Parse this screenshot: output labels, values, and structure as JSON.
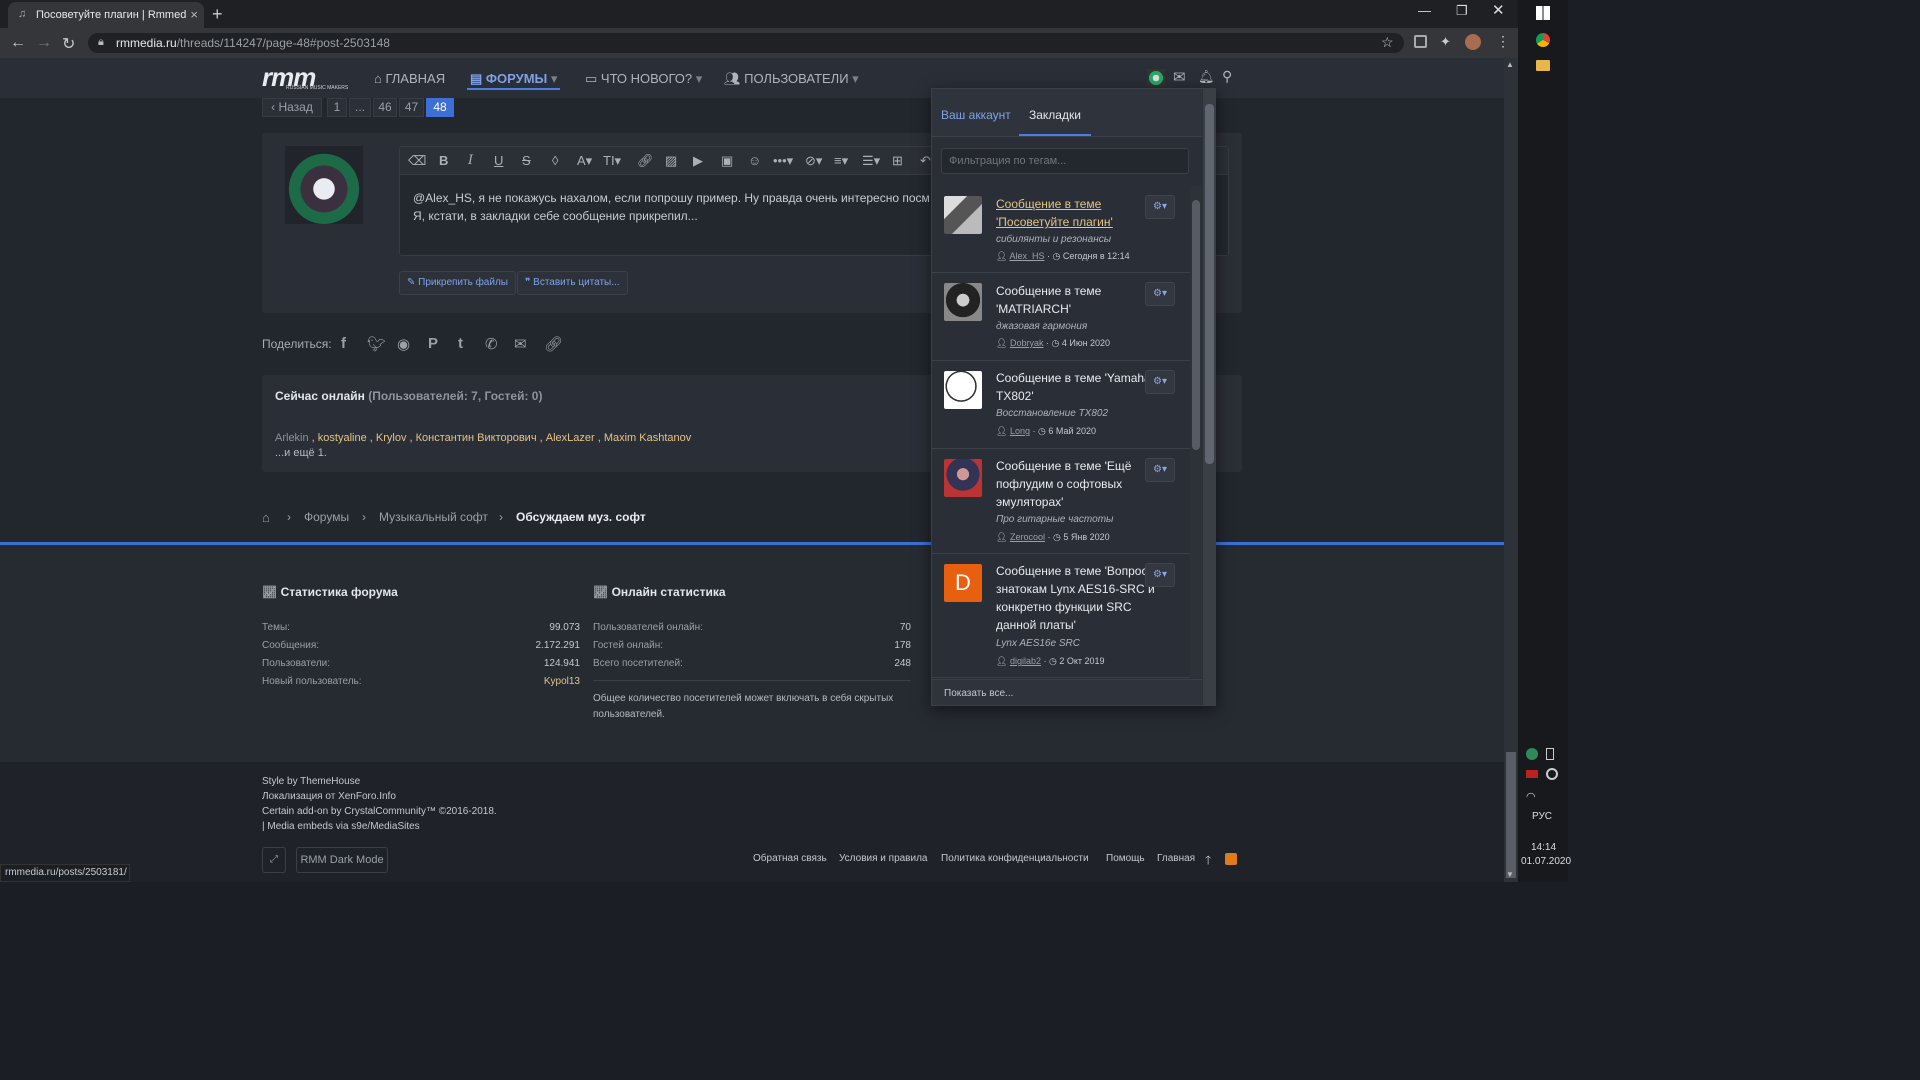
{
  "browser": {
    "tab_title": "Посоветуйте плагин | Rmmedia.",
    "url_host": "rmmedia.ru",
    "url_path": "/threads/114247/page-48#post-2503148",
    "status_url": "rmmedia.ru/posts/2503181/"
  },
  "site": {
    "logo_text": "rmm",
    "logo_sub": "RUSSIAN MUSIC MAKERS",
    "nav": {
      "home": "ГЛАВНАЯ",
      "forums": "ФОРУМЫ",
      "whats_new": "ЧТО НОВОГО?",
      "users": "ПОЛЬЗОВАТЕЛИ"
    }
  },
  "pagination": {
    "back": "Назад",
    "pages": [
      "1",
      "...",
      "46",
      "47",
      "48"
    ],
    "current": "48"
  },
  "editor": {
    "text_line1": "@Alex_HS, я не покажусь нахалом, если попрошу пример. Ну правда очень интересно посм",
    "text_line2": "Я, кстати, в закладки себе сообщение прикрепил...",
    "attach": "Прикрепить файлы",
    "insert_quotes": "Вставить цитаты..."
  },
  "share": {
    "label": "Поделиться:"
  },
  "online": {
    "title": "Сейчас онлайн",
    "counts": "(Пользователей: 7, Гостей: 0)",
    "users": [
      "Arlekin",
      "kostyaline",
      "Krylov",
      "Константин Викторович",
      "AlexLazer",
      "Maxim Kashtanov"
    ],
    "more": "...и ещё 1."
  },
  "breadcrumb": {
    "forums": "Форумы",
    "music_soft": "Музыкальный софт",
    "current": "Обсуждаем муз. софт"
  },
  "stats": {
    "forum_title": "Статистика форума",
    "forum": [
      {
        "label": "Темы:",
        "value": "99.073"
      },
      {
        "label": "Сообщения:",
        "value": "2.172.291"
      },
      {
        "label": "Пользователи:",
        "value": "124.941"
      },
      {
        "label": "Новый пользователь:",
        "value": "Kypol13"
      }
    ],
    "online_title": "Онлайн статистика",
    "online": [
      {
        "label": "Пользователей онлайн:",
        "value": "70"
      },
      {
        "label": "Гостей онлайн:",
        "value": "178"
      },
      {
        "label": "Всего посетителей:",
        "value": "248"
      }
    ],
    "note": "Общее количество посетителей может включать в себя скрытых пользователей."
  },
  "footer": {
    "line1": "Style by ThemeHouse",
    "line2a": "Локализация от ",
    "line2b": "XenForo.Info",
    "line3": "Certain add-on by CrystalCommunity™ ©2016-2018.",
    "line4": "| Media embeds via s9e/MediaSites",
    "dark_mode": "RMM Dark Mode",
    "links": [
      "Обратная связь",
      "Условия и правила",
      "Политика конфиденциальности",
      "Помощь",
      "Главная"
    ]
  },
  "popup": {
    "tab_account": "Ваш аккаунт",
    "tab_bookmarks": "Закладки",
    "filter_placeholder": "Фильтрация по тегам...",
    "show_all": "Показать все...",
    "items": [
      {
        "title": "Сообщение в теме 'Посоветуйте плагин'",
        "subtitle": "сибилянты и резонансы",
        "author": "Alex_HS",
        "date": "Сегодня в 12:14"
      },
      {
        "title": "Сообщение в теме 'MATRIARCH'",
        "subtitle": "джазовая гармония",
        "author": "Dobryak",
        "date": "4 Июн 2020"
      },
      {
        "title": "Сообщение в теме 'Yamaha TX802'",
        "subtitle": "Восстановление TX802",
        "author": "Long",
        "date": "6 Май 2020"
      },
      {
        "title": "Сообщение в теме 'Ещё пофлудим о софтовых эмуляторах'",
        "subtitle": "Про гитарные частоты",
        "author": "Zerocool",
        "date": "5 Янв 2020"
      },
      {
        "title": "Сообщение в теме 'Вопрос знатокам Lynx AES16-SRC и конкретно функции SRC данной платы'",
        "subtitle": "Lynx AES16e SRC",
        "author": "digilab2",
        "date": "2 Окт 2019",
        "avatar_letter": "D"
      }
    ]
  },
  "taskbar": {
    "lang": "РУС",
    "time": "14:14",
    "date": "01.07.2020"
  },
  "colors": {
    "accent": "#4a7fe0",
    "username": "#e3c488",
    "background": "#22262d"
  }
}
